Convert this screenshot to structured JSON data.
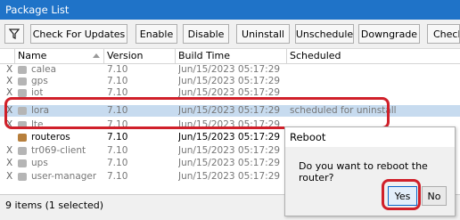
{
  "window": {
    "title": "Package List"
  },
  "toolbar": {
    "filter_icon": "filter-icon",
    "buttons": [
      "Check For Updates",
      "Enable",
      "Disable",
      "Uninstall",
      "Unschedule",
      "Downgrade",
      "Check"
    ]
  },
  "table": {
    "columns": [
      "Name",
      "Version",
      "Build Time",
      "Scheduled"
    ],
    "rows": [
      {
        "flag": "X",
        "name": "calea",
        "version": "7.10",
        "build_time": "Jun/15/2023 05:17:29",
        "scheduled": ""
      },
      {
        "flag": "X",
        "name": "gps",
        "version": "7.10",
        "build_time": "Jun/15/2023 05:17:29",
        "scheduled": ""
      },
      {
        "flag": "X",
        "name": "iot",
        "version": "7.10",
        "build_time": "Jun/15/2023 05:17:29",
        "scheduled": ""
      },
      {
        "flag": "X",
        "name": "lora",
        "version": "7.10",
        "build_time": "Jun/15/2023 05:17:29",
        "scheduled": "scheduled for uninstall"
      },
      {
        "flag": "X",
        "name": "lte",
        "version": "7.10",
        "build_time": "Jun/15/2023 05:17:29",
        "scheduled": ""
      },
      {
        "flag": "",
        "name": "routeros",
        "version": "7.10",
        "build_time": "Jun/15/2023 05:17:29",
        "scheduled": ""
      },
      {
        "flag": "X",
        "name": "tr069-client",
        "version": "7.10",
        "build_time": "Jun/15/2023 05:17:29",
        "scheduled": ""
      },
      {
        "flag": "X",
        "name": "ups",
        "version": "7.10",
        "build_time": "Jun/15/2023 05:17:29",
        "scheduled": ""
      },
      {
        "flag": "X",
        "name": "user-manager",
        "version": "7.10",
        "build_time": "Jun/15/2023 05:17:29",
        "scheduled": ""
      }
    ]
  },
  "status": {
    "text": "9 items (1 selected)"
  },
  "dialog": {
    "title": "Reboot",
    "message": "Do you want to reboot the router?",
    "yes_label": "Yes",
    "no_label": "No"
  },
  "colors": {
    "titlebar": "#1f73c8",
    "selection": "#c7dbef",
    "highlight": "#d0202a"
  }
}
